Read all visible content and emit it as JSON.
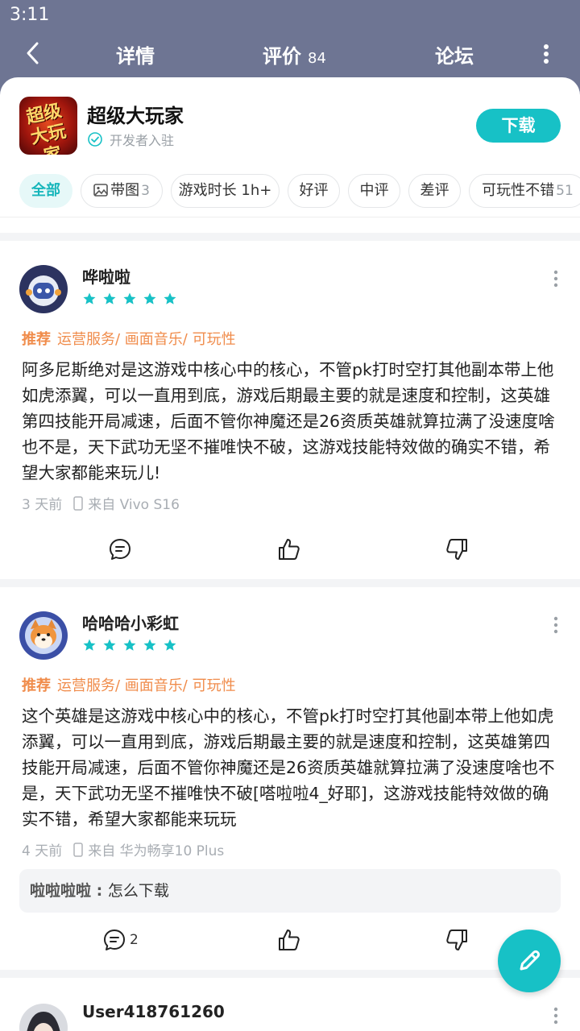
{
  "status_bar": {
    "time": "3:11"
  },
  "nav": {
    "detail": "详情",
    "reviews": "评价",
    "reviews_count": "84",
    "forum": "论坛"
  },
  "app": {
    "icon_text": "超级大玩家",
    "name": "超级大玩家",
    "developer_badge": "开发者入驻",
    "download": "下载"
  },
  "filters": [
    {
      "label": "全部",
      "count": ""
    },
    {
      "label": "带图",
      "count": "3"
    },
    {
      "label": "游戏时长 1h+",
      "count": ""
    },
    {
      "label": "好评",
      "count": ""
    },
    {
      "label": "中评",
      "count": ""
    },
    {
      "label": "差评",
      "count": ""
    },
    {
      "label": "可玩性不错",
      "count": "51"
    }
  ],
  "reviews": [
    {
      "user": "哗啦啦",
      "stars": 5,
      "recommend": "推荐",
      "tags": "运营服务/ 画面音乐/ 可玩性",
      "text": "阿多尼斯绝对是这游戏中核心中的核心，不管pk打时空打其他副本带上他如虎添翼，可以一直用到底，游戏后期最主要的就是速度和控制，这英雄第四技能开局减速，后面不管你神魔还是26资质英雄就算拉满了没速度啥也不是，天下武功无坚不摧唯快不破，这游戏技能特效做的确实不错，希望大家都能来玩儿!",
      "time": "3 天前",
      "device": "来自 Vivo S16",
      "comment_count": ""
    },
    {
      "user": "哈哈哈小彩虹",
      "stars": 5,
      "recommend": "推荐",
      "tags": "运营服务/ 画面音乐/ 可玩性",
      "text": "这个英雄是这游戏中核心中的核心，不管pk打时空打其他副本带上他如虎添翼，可以一直用到底，游戏后期最主要的就是速度和控制，这英雄第四技能开局减速，后面不管你神魔还是26资质英雄就算拉满了没速度啥也不是，天下武功无坚不摧唯快不破[嗒啦啦4_好耶]，这游戏技能特效做的确实不错，希望大家都能来玩玩",
      "time": "4 天前",
      "device": "来自 华为畅享10 Plus",
      "reply_user": "啦啦啦啦",
      "reply_text": "怎么下载",
      "comment_count": "2"
    },
    {
      "user": "User418761260"
    }
  ],
  "colors": {
    "accent": "#17c1c6",
    "tag": "#f08c4b",
    "header": "#6e7593"
  }
}
